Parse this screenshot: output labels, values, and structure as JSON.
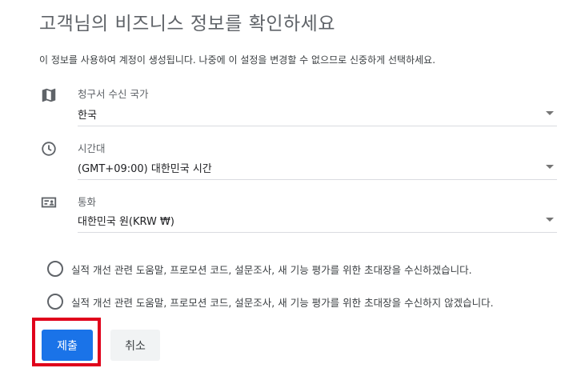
{
  "header": {
    "title": "고객님의 비즈니스 정보를 확인하세요",
    "description": "이 정보를 사용하여 계정이 생성됩니다. 나중에 이 설정을 변경할 수 없으므로 신중하게 선택하세요."
  },
  "fields": [
    {
      "icon": "map-icon",
      "label": "청구서 수신 국가",
      "value": "한국"
    },
    {
      "icon": "clock-icon",
      "label": "시간대",
      "value": "(GMT+09:00) 대한민국 시간"
    },
    {
      "icon": "currency-icon",
      "label": "통화",
      "value": "대한민국 원(KRW ₩)"
    }
  ],
  "email_options": [
    {
      "label": "실적 개선 관련 도움말, 프로모션 코드, 설문조사, 새 기능 평가를 위한 초대장을 수신하겠습니다.",
      "selected": false
    },
    {
      "label": "실적 개선 관련 도움말, 프로모션 코드, 설문조사, 새 기능 평가를 위한 초대장을 수신하지 않겠습니다.",
      "selected": false
    }
  ],
  "actions": {
    "submit_label": "제출",
    "cancel_label": "취소"
  },
  "colors": {
    "accent": "#1a73e8",
    "highlight": "#e0001b"
  }
}
